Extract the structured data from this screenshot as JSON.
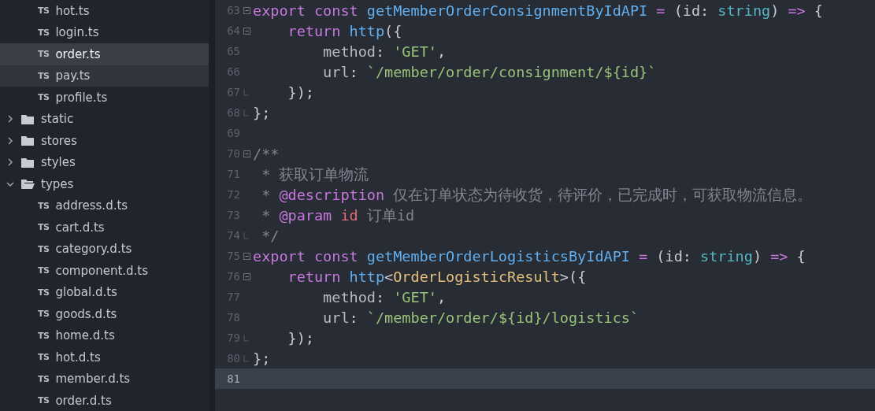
{
  "sidebar": {
    "nested_files": [
      {
        "badge": "TS",
        "name": "hot.ts",
        "selected": false,
        "hovered": false
      },
      {
        "badge": "TS",
        "name": "login.ts",
        "selected": false,
        "hovered": false
      },
      {
        "badge": "TS",
        "name": "order.ts",
        "selected": true,
        "hovered": false
      },
      {
        "badge": "TS",
        "name": "pay.ts",
        "selected": false,
        "hovered": true
      },
      {
        "badge": "TS",
        "name": "profile.ts",
        "selected": false,
        "hovered": false
      }
    ],
    "items": [
      {
        "kind": "folder",
        "name": "static",
        "expanded": false
      },
      {
        "kind": "folder",
        "name": "stores",
        "expanded": false
      },
      {
        "kind": "folder",
        "name": "styles",
        "expanded": false
      },
      {
        "kind": "folder",
        "name": "types",
        "expanded": true,
        "children": [
          {
            "kind": "file",
            "badge": "TS",
            "name": "address.d.ts"
          },
          {
            "kind": "file",
            "badge": "TS",
            "name": "cart.d.ts"
          },
          {
            "kind": "file",
            "badge": "TS",
            "name": "category.d.ts"
          },
          {
            "kind": "file",
            "badge": "TS",
            "name": "component.d.ts"
          },
          {
            "kind": "file",
            "badge": "TS",
            "name": "global.d.ts"
          },
          {
            "kind": "file",
            "badge": "TS",
            "name": "goods.d.ts"
          },
          {
            "kind": "file",
            "badge": "TS",
            "name": "home.d.ts"
          },
          {
            "kind": "file",
            "badge": "TS",
            "name": "hot.d.ts"
          },
          {
            "kind": "file",
            "badge": "TS",
            "name": "member.d.ts"
          },
          {
            "kind": "file",
            "badge": "TS",
            "name": "order.d.ts"
          }
        ]
      }
    ]
  },
  "editor": {
    "lines": [
      {
        "number": "63",
        "fold_start": true,
        "fold_end": false,
        "current": false,
        "tokens": [
          {
            "kind": "keyword",
            "text": "export const "
          },
          {
            "kind": "function",
            "text": "getMemberOrderConsignmentByIdAPI"
          },
          {
            "kind": "operator",
            "text": " = "
          },
          {
            "kind": "punct",
            "text": "(id: "
          },
          {
            "kind": "type",
            "text": "string"
          },
          {
            "kind": "punct",
            "text": ") "
          },
          {
            "kind": "operator",
            "text": "=>"
          },
          {
            "kind": "punct",
            "text": " {"
          }
        ]
      },
      {
        "number": "64",
        "fold_start": true,
        "fold_end": false,
        "current": false,
        "tokens": [
          {
            "kind": "keyword",
            "text": "    return "
          },
          {
            "kind": "function",
            "text": "http"
          },
          {
            "kind": "punct",
            "text": "({"
          }
        ]
      },
      {
        "number": "65",
        "fold_start": false,
        "fold_end": false,
        "current": false,
        "tokens": [
          {
            "kind": "property",
            "text": "        method"
          },
          {
            "kind": "punct",
            "text": ": "
          },
          {
            "kind": "string",
            "text": "'GET'"
          },
          {
            "kind": "punct",
            "text": ","
          }
        ]
      },
      {
        "number": "66",
        "fold_start": false,
        "fold_end": false,
        "current": false,
        "tokens": [
          {
            "kind": "property",
            "text": "        url"
          },
          {
            "kind": "punct",
            "text": ": "
          },
          {
            "kind": "string",
            "text": "`/member/order/consignment/${id}`"
          }
        ]
      },
      {
        "number": "67",
        "fold_start": false,
        "fold_end": true,
        "current": false,
        "tokens": [
          {
            "kind": "punct",
            "text": "    });"
          }
        ]
      },
      {
        "number": "68",
        "fold_start": false,
        "fold_end": true,
        "current": false,
        "tokens": [
          {
            "kind": "punct",
            "text": "};"
          }
        ]
      },
      {
        "number": "69",
        "fold_start": false,
        "fold_end": false,
        "current": false
      },
      {
        "number": "70",
        "fold_start": true,
        "fold_end": false,
        "current": false,
        "tokens": [
          {
            "kind": "comment",
            "text": "/**"
          }
        ]
      },
      {
        "number": "71",
        "fold_start": false,
        "fold_end": false,
        "current": false,
        "tokens": [
          {
            "kind": "comment",
            "text": " * 获取订单物流"
          }
        ]
      },
      {
        "number": "72",
        "fold_start": false,
        "fold_end": false,
        "current": false,
        "tokens": [
          {
            "kind": "comment",
            "text": " * "
          },
          {
            "kind": "doctag",
            "text": "@description"
          },
          {
            "kind": "comment",
            "text": " 仅在订单状态为待收货，待评价，已完成时，可获取物流信息。"
          }
        ]
      },
      {
        "number": "73",
        "fold_start": false,
        "fold_end": false,
        "current": false,
        "tokens": [
          {
            "kind": "comment",
            "text": " * "
          },
          {
            "kind": "doctag",
            "text": "@param"
          },
          {
            "kind": "param",
            "text": " id"
          },
          {
            "kind": "comment",
            "text": " 订单id"
          }
        ]
      },
      {
        "number": "74",
        "fold_start": false,
        "fold_end": true,
        "current": false,
        "tokens": [
          {
            "kind": "comment",
            "text": " */"
          }
        ]
      },
      {
        "number": "75",
        "fold_start": true,
        "fold_end": false,
        "current": false,
        "tokens": [
          {
            "kind": "keyword",
            "text": "export const "
          },
          {
            "kind": "function",
            "text": "getMemberOrderLogisticsByIdAPI"
          },
          {
            "kind": "operator",
            "text": " = "
          },
          {
            "kind": "punct",
            "text": "(id: "
          },
          {
            "kind": "type",
            "text": "string"
          },
          {
            "kind": "punct",
            "text": ") "
          },
          {
            "kind": "operator",
            "text": "=>"
          },
          {
            "kind": "punct",
            "text": " {"
          }
        ]
      },
      {
        "number": "76",
        "fold_start": true,
        "fold_end": false,
        "current": false,
        "tokens": [
          {
            "kind": "keyword",
            "text": "    return "
          },
          {
            "kind": "function",
            "text": "http"
          },
          {
            "kind": "punct",
            "text": "<"
          },
          {
            "kind": "generic",
            "text": "OrderLogisticResult"
          },
          {
            "kind": "punct",
            "text": ">({"
          }
        ]
      },
      {
        "number": "77",
        "fold_start": false,
        "fold_end": false,
        "current": false,
        "tokens": [
          {
            "kind": "property",
            "text": "        method"
          },
          {
            "kind": "punct",
            "text": ": "
          },
          {
            "kind": "string",
            "text": "'GET'"
          },
          {
            "kind": "punct",
            "text": ","
          }
        ]
      },
      {
        "number": "78",
        "fold_start": false,
        "fold_end": false,
        "current": false,
        "tokens": [
          {
            "kind": "property",
            "text": "        url"
          },
          {
            "kind": "punct",
            "text": ": "
          },
          {
            "kind": "string",
            "text": "`/member/order/${id}/logistics`"
          }
        ]
      },
      {
        "number": "79",
        "fold_start": false,
        "fold_end": true,
        "current": false,
        "tokens": [
          {
            "kind": "punct",
            "text": "    });"
          }
        ]
      },
      {
        "number": "80",
        "fold_start": false,
        "fold_end": true,
        "current": false,
        "tokens": [
          {
            "kind": "punct",
            "text": "};"
          }
        ]
      },
      {
        "number": "81",
        "fold_start": false,
        "fold_end": false,
        "current": true
      }
    ]
  }
}
